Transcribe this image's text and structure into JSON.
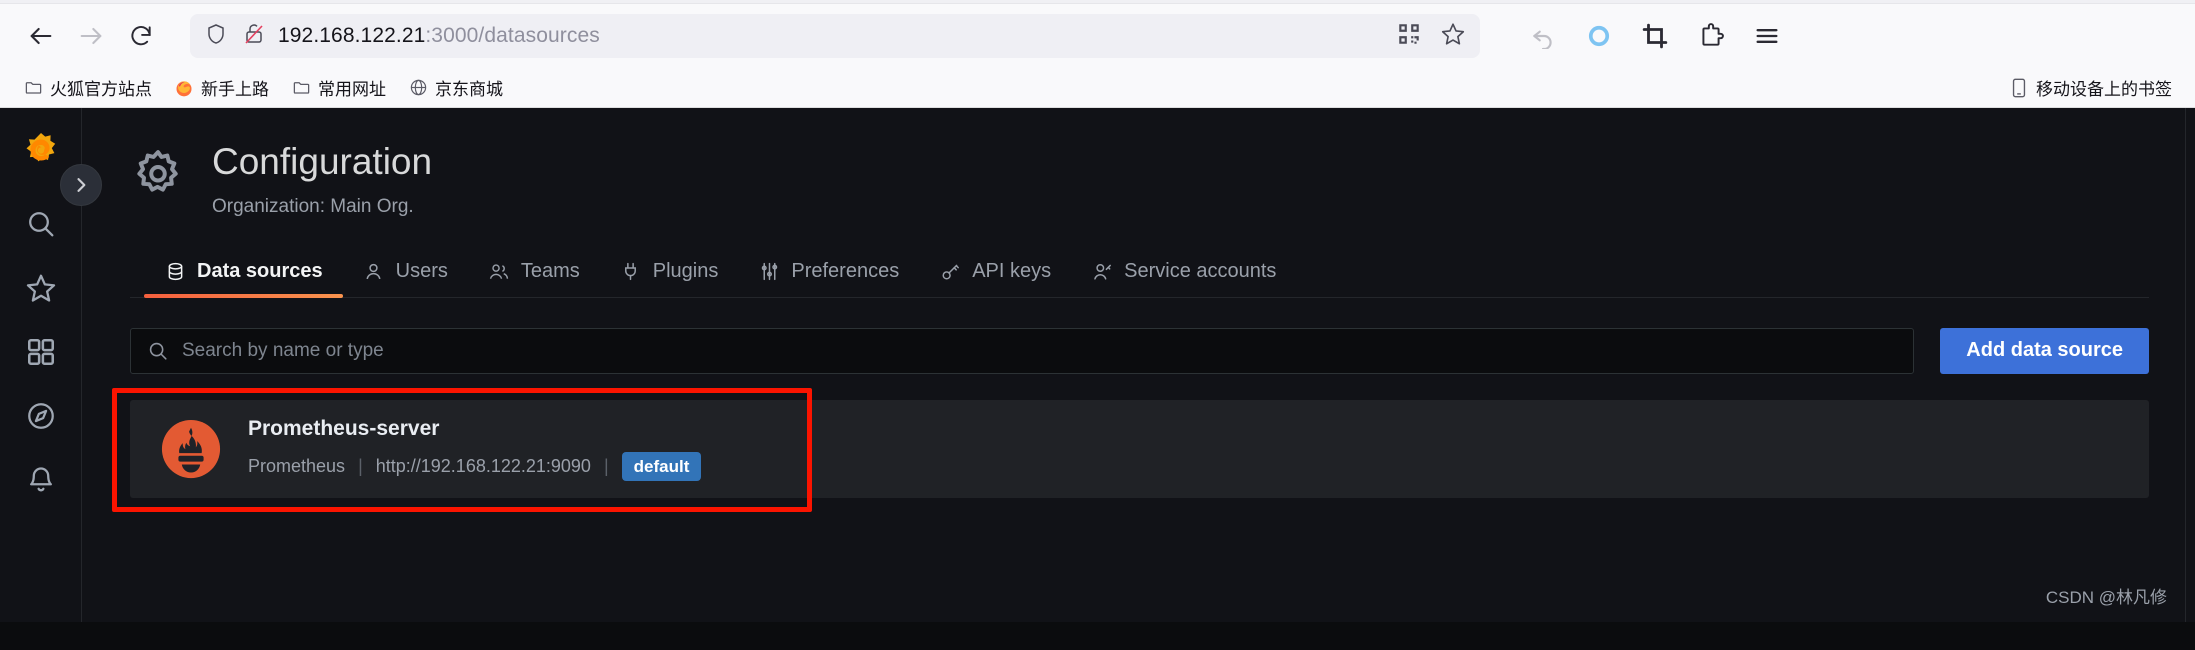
{
  "browser": {
    "nav": {
      "back_label": "Back",
      "forward_label": "Forward",
      "reload_label": "Reload"
    },
    "url": {
      "host": "192.168.122.21",
      "path": ":3000/datasources",
      "shield_icon": "shield-icon",
      "lock_broken_icon": "lock-broken-icon",
      "qr_icon": "qr-code-icon",
      "bookmark_star_icon": "star-icon"
    },
    "toolbar": {
      "items": [
        {
          "name": "undo-arrow-icon",
          "label": "Undo"
        },
        {
          "name": "pocket-circle-icon",
          "label": "Sync"
        },
        {
          "name": "crop-icon",
          "label": "Screenshot"
        },
        {
          "name": "extension-icon",
          "label": "Extensions"
        },
        {
          "name": "menu-hamburger-icon",
          "label": "Application menu"
        }
      ]
    },
    "bookmarks": {
      "items": [
        {
          "label": "火狐官方站点",
          "icon": "folder-icon"
        },
        {
          "label": "新手上路",
          "icon": "firefox-icon"
        },
        {
          "label": "常用网址",
          "icon": "folder-icon"
        },
        {
          "label": "京东商城",
          "icon": "globe-icon"
        }
      ],
      "mobile_label": "移动设备上的书签",
      "mobile_icon": "mobile-phone-icon"
    }
  },
  "sidebar": {
    "logo": "grafana-logo-icon",
    "expand_label": "Expand menu",
    "items": [
      {
        "name": "sidebar-item-search",
        "icon": "search-icon",
        "label": "Search"
      },
      {
        "name": "sidebar-item-starred",
        "icon": "star-icon",
        "label": "Starred"
      },
      {
        "name": "sidebar-item-dashboards",
        "icon": "apps-grid-icon",
        "label": "Dashboards"
      },
      {
        "name": "sidebar-item-explore",
        "icon": "compass-icon",
        "label": "Explore"
      },
      {
        "name": "sidebar-item-alerting",
        "icon": "bell-icon",
        "label": "Alerting"
      }
    ]
  },
  "page": {
    "icon": "gear-icon",
    "title": "Configuration",
    "subtitle": "Organization: Main Org."
  },
  "tabs": [
    {
      "label": "Data sources",
      "icon": "database-icon",
      "active": true
    },
    {
      "label": "Users",
      "icon": "user-icon",
      "active": false
    },
    {
      "label": "Teams",
      "icon": "users-icon",
      "active": false
    },
    {
      "label": "Plugins",
      "icon": "plug-icon",
      "active": false
    },
    {
      "label": "Preferences",
      "icon": "sliders-icon",
      "active": false
    },
    {
      "label": "API keys",
      "icon": "key-icon",
      "active": false
    },
    {
      "label": "Service accounts",
      "icon": "user-key-icon",
      "active": false
    }
  ],
  "search": {
    "placeholder": "Search by name or type",
    "value": "",
    "icon": "search-icon"
  },
  "add_button": {
    "label": "Add data source"
  },
  "datasources": [
    {
      "name": "Prometheus-server",
      "type": "Prometheus",
      "url": "http://192.168.122.21:9090",
      "badge": "default",
      "logo": "prometheus-logo-icon",
      "separator": "|"
    }
  ],
  "watermark": "CSDN @林凡修",
  "colors": {
    "accent_orange": "#f55f3e",
    "primary_blue": "#3d71d9",
    "badge_blue": "#3274b8",
    "highlight_red": "#fb1400",
    "prometheus_orange": "#e35a33",
    "card_bg": "#202226",
    "app_bg": "#111217"
  }
}
